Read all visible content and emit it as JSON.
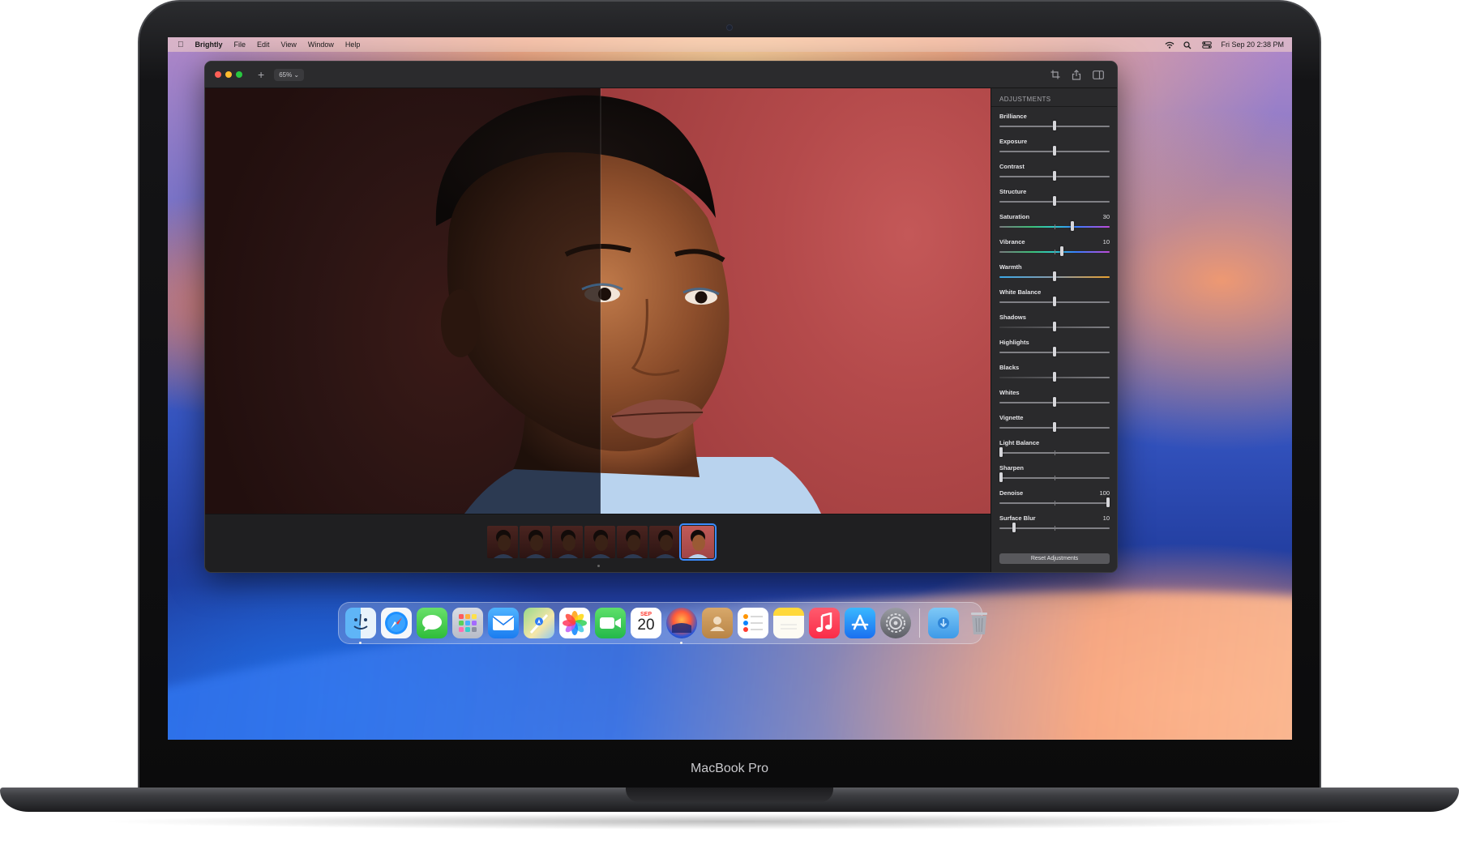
{
  "menubar": {
    "app_name": "Brightly",
    "items": [
      "File",
      "Edit",
      "View",
      "Window",
      "Help"
    ],
    "clock": "Fri Sep 20  2:38 PM"
  },
  "toolbar": {
    "zoom_level": "65%",
    "icons": [
      "crop-icon",
      "share-icon",
      "sidebar-icon"
    ]
  },
  "adjustments": {
    "title": "ADJUSTMENTS",
    "sliders": [
      {
        "label": "Brilliance",
        "value": "",
        "position": 0.5,
        "track": "gray"
      },
      {
        "label": "Exposure",
        "value": "",
        "position": 0.5,
        "track": "gray"
      },
      {
        "label": "Contrast",
        "value": "",
        "position": 0.5,
        "track": "gray"
      },
      {
        "label": "Structure",
        "value": "",
        "position": 0.5,
        "track": "gray"
      },
      {
        "label": "Saturation",
        "value": "30",
        "position": 0.67,
        "track": "spectrum"
      },
      {
        "label": "Vibrance",
        "value": "10",
        "position": 0.57,
        "track": "spectrum"
      },
      {
        "label": "Warmth",
        "value": "",
        "position": 0.5,
        "track": "warm"
      },
      {
        "label": "White Balance",
        "value": "",
        "position": 0.5,
        "track": "gray"
      },
      {
        "label": "Shadows",
        "value": "",
        "position": 0.5,
        "track": "shadow"
      },
      {
        "label": "Highlights",
        "value": "",
        "position": 0.5,
        "track": "gray"
      },
      {
        "label": "Blacks",
        "value": "",
        "position": 0.5,
        "track": "shadow"
      },
      {
        "label": "Whites",
        "value": "",
        "position": 0.5,
        "track": "gray"
      },
      {
        "label": "Vignette",
        "value": "",
        "position": 0.5,
        "track": "gray"
      },
      {
        "label": "Light Balance",
        "value": "",
        "position": 0.0,
        "track": "gray"
      },
      {
        "label": "Sharpen",
        "value": "",
        "position": 0.0,
        "track": "gray"
      },
      {
        "label": "Denoise",
        "value": "100",
        "position": 1.0,
        "track": "gray"
      },
      {
        "label": "Surface Blur",
        "value": "10",
        "position": 0.12,
        "track": "gray"
      }
    ],
    "reset_label": "Reset Adjustments"
  },
  "filmstrip": {
    "thumbnail_count": 7,
    "selected_index": 6
  },
  "dock": {
    "apps": [
      "finder-icon",
      "safari-icon",
      "messages-icon",
      "launchpad-icon",
      "mail-icon",
      "maps-icon",
      "photos-icon",
      "facetime-icon",
      "calendar-icon",
      "brightly-icon",
      "contacts-icon",
      "reminders-icon",
      "notes-icon",
      "music-icon",
      "app-store-icon",
      "system-settings-icon"
    ],
    "calendar_month": "SEP",
    "calendar_day": "20",
    "extras": [
      "downloads-icon",
      "trash-icon"
    ]
  },
  "device_label": "MacBook Pro",
  "colors": {
    "selection_accent": "#3a8cff",
    "backdrop_red": "#b44a4b"
  }
}
